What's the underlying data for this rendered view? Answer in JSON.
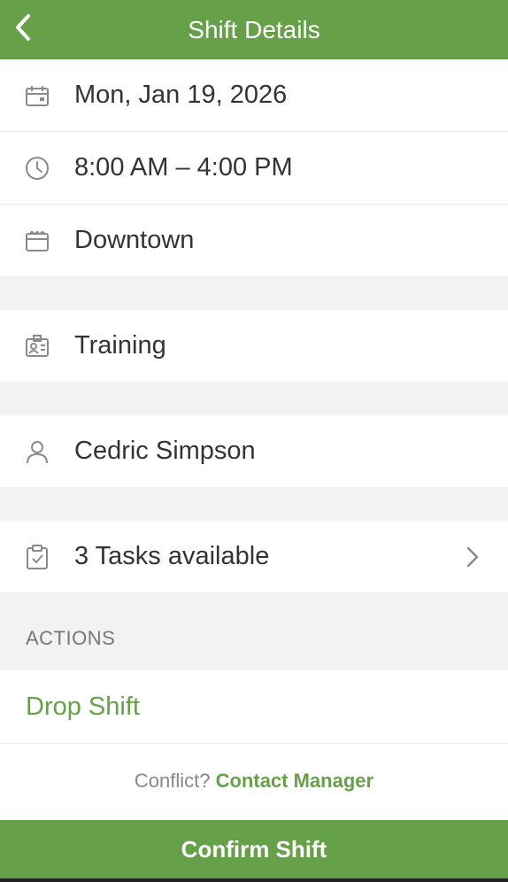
{
  "header": {
    "title": "Shift Details",
    "back_icon": "chevron-left-icon"
  },
  "details": {
    "date": "Mon, Jan 19, 2026",
    "time": "8:00 AM – 4:00 PM",
    "location": "Downtown",
    "position": "Training",
    "person": "Cedric Simpson",
    "tasks": "3 Tasks available"
  },
  "actions": {
    "section_label": "ACTIONS",
    "drop_label": "Drop Shift",
    "conflict_text": "Conflict?",
    "contact_label": "Contact Manager",
    "confirm_label": "Confirm Shift"
  },
  "colors": {
    "accent": "#66a049",
    "background": "#f2f2f2",
    "icon": "#8a8a8a"
  }
}
